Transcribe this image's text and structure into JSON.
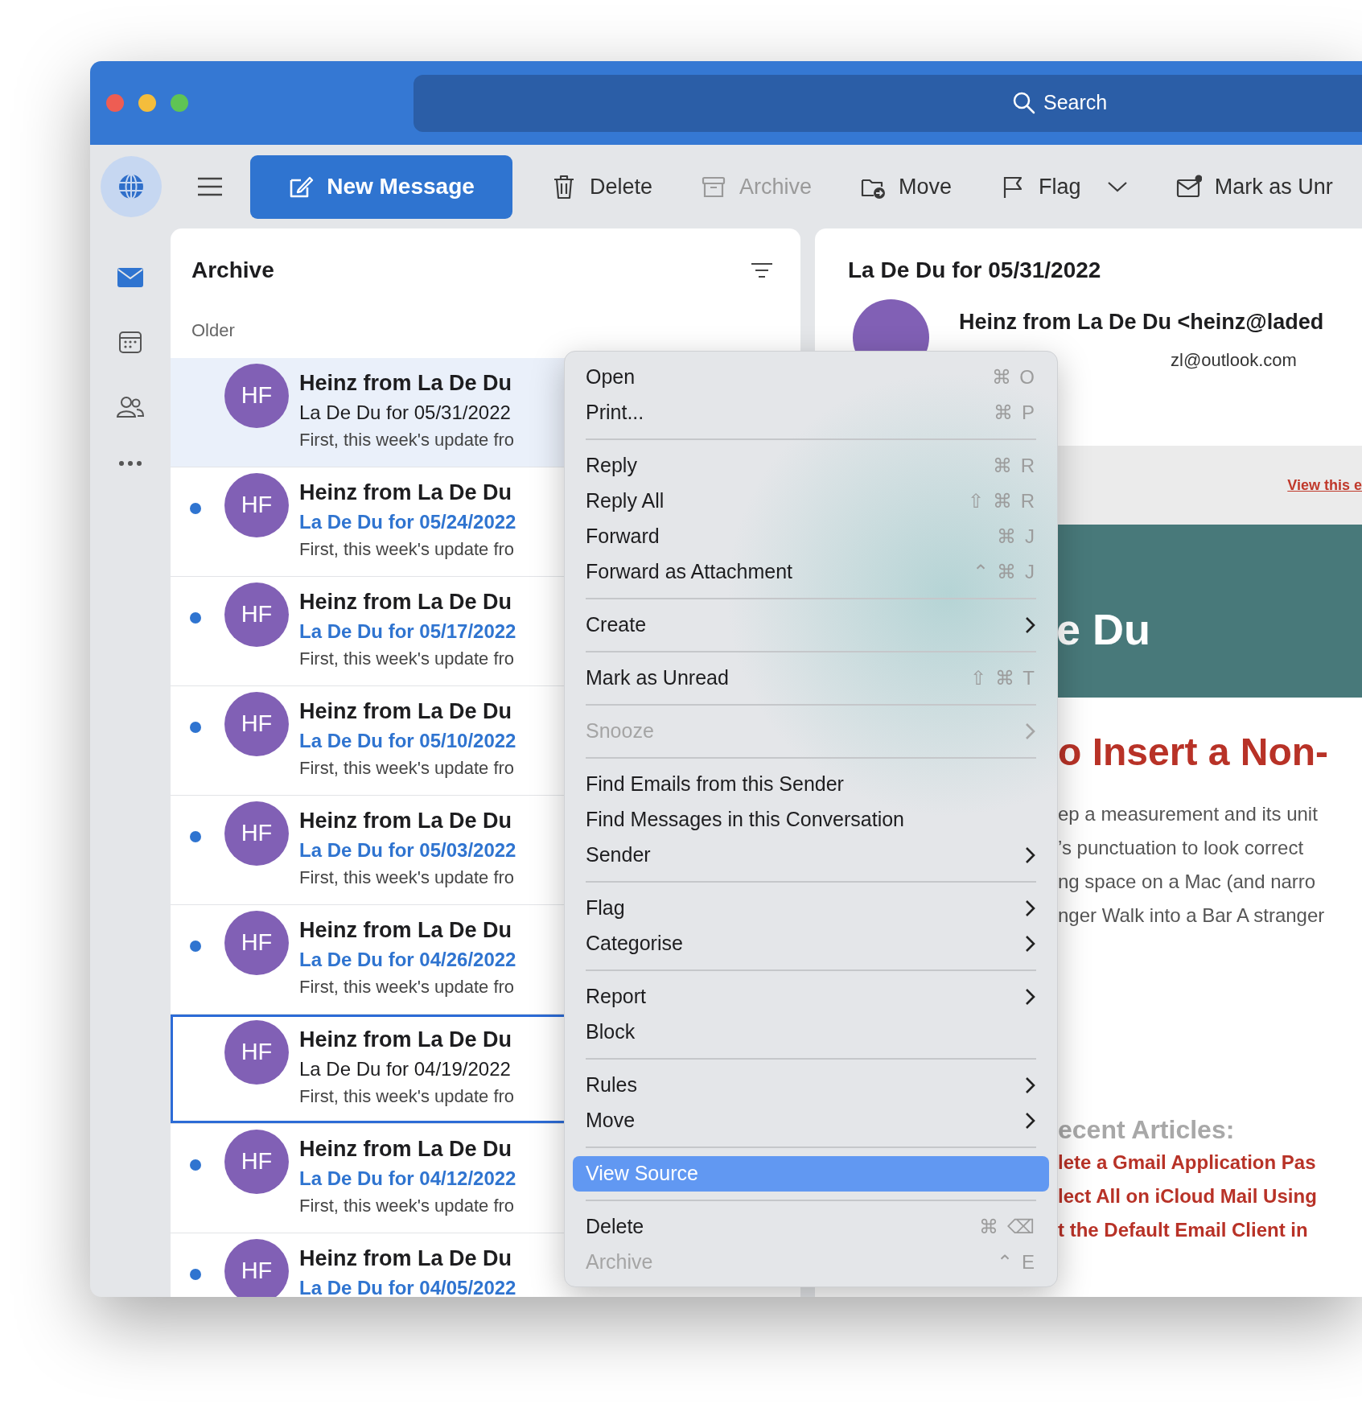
{
  "search": {
    "placeholder": "Search"
  },
  "toolbar": [
    {
      "label": "New Message",
      "kind": "compose",
      "disabled": false
    },
    {
      "label": "Delete",
      "kind": "delete",
      "disabled": false
    },
    {
      "label": "Archive",
      "kind": "archive",
      "disabled": true
    },
    {
      "label": "Move",
      "kind": "move",
      "disabled": false
    },
    {
      "label": "Flag",
      "kind": "flag",
      "disabled": false,
      "dropdown": true
    },
    {
      "label": "Mark as Unr",
      "kind": "unread",
      "disabled": false
    }
  ],
  "nav_rail": [
    {
      "kind": "mail",
      "selected": true
    },
    {
      "kind": "calendar",
      "selected": false
    },
    {
      "kind": "people",
      "selected": false
    },
    {
      "kind": "more",
      "selected": false
    }
  ],
  "message_list": {
    "title": "Archive",
    "group": "Older",
    "messages": [
      {
        "initials": "HF",
        "sender": "Heinz from La De Du",
        "subject": "La De Du for 05/31/2022",
        "preview": "First, this week's update fro",
        "unread": false,
        "selected": true,
        "focused": false
      },
      {
        "initials": "HF",
        "sender": "Heinz from La De Du",
        "subject": "La De Du for 05/24/2022",
        "preview": "First, this week's update fro",
        "unread": true,
        "selected": false,
        "focused": false
      },
      {
        "initials": "HF",
        "sender": "Heinz from La De Du",
        "subject": "La De Du for 05/17/2022",
        "preview": "First, this week's update fro",
        "unread": true,
        "selected": false,
        "focused": false
      },
      {
        "initials": "HF",
        "sender": "Heinz from La De Du",
        "subject": "La De Du for 05/10/2022",
        "preview": "First, this week's update fro",
        "unread": true,
        "selected": false,
        "focused": false
      },
      {
        "initials": "HF",
        "sender": "Heinz from La De Du",
        "subject": "La De Du for 05/03/2022",
        "preview": "First, this week's update fro",
        "unread": true,
        "selected": false,
        "focused": false
      },
      {
        "initials": "HF",
        "sender": "Heinz from La De Du",
        "subject": "La De Du for 04/26/2022",
        "preview": "First, this week's update fro",
        "unread": true,
        "selected": false,
        "focused": false
      },
      {
        "initials": "HF",
        "sender": "Heinz from La De Du",
        "subject": "La De Du for 04/19/2022",
        "preview": "First, this week's update fro",
        "unread": false,
        "selected": false,
        "focused": true
      },
      {
        "initials": "HF",
        "sender": "Heinz from La De Du",
        "subject": "La De Du for 04/12/2022",
        "preview": "First, this week's update fro",
        "unread": true,
        "selected": false,
        "focused": false
      },
      {
        "initials": "HF",
        "sender": "Heinz from La De Du",
        "subject": "La De Du for 04/05/2022",
        "unread": true,
        "selected": false,
        "focused": false
      }
    ]
  },
  "reading_pane": {
    "subject": "La De Du for 05/31/2022",
    "from": "Heinz from La De Du <heinz@laded",
    "to": "zl@outlook.com",
    "view_online": "View this e",
    "banner_title": "e Du",
    "heading": "o Insert a Non-",
    "body_lines": [
      "ep a measurement and its unit",
      "’s punctuation to look correct",
      "ng space on a Mac (and narro",
      "nger Walk into a Bar A stranger"
    ],
    "articles_title": "ecent Articles:",
    "articles": [
      "lete a Gmail Application Pas",
      "lect All on iCloud Mail Using",
      "t the Default Email Client in"
    ]
  },
  "context_menu": [
    {
      "kind": "item",
      "label": "Open",
      "shortcut": "⌘ O",
      "submenu": false,
      "disabled": false,
      "selected": false
    },
    {
      "kind": "item",
      "label": "Print...",
      "shortcut": "⌘ P",
      "submenu": false,
      "disabled": false,
      "selected": false
    },
    {
      "kind": "separator"
    },
    {
      "kind": "item",
      "label": "Reply",
      "shortcut": "⌘ R",
      "submenu": false,
      "disabled": false,
      "selected": false
    },
    {
      "kind": "item",
      "label": "Reply All",
      "shortcut": "⇧ ⌘ R",
      "submenu": false,
      "disabled": false,
      "selected": false
    },
    {
      "kind": "item",
      "label": "Forward",
      "shortcut": "⌘ J",
      "submenu": false,
      "disabled": false,
      "selected": false
    },
    {
      "kind": "item",
      "label": "Forward as Attachment",
      "shortcut": "⌃ ⌘ J",
      "submenu": false,
      "disabled": false,
      "selected": false
    },
    {
      "kind": "separator"
    },
    {
      "kind": "item",
      "label": "Create",
      "submenu": true,
      "disabled": false,
      "selected": false
    },
    {
      "kind": "separator"
    },
    {
      "kind": "item",
      "label": "Mark as Unread",
      "shortcut": "⇧ ⌘ T",
      "submenu": false,
      "disabled": false,
      "selected": false
    },
    {
      "kind": "separator"
    },
    {
      "kind": "item",
      "label": "Snooze",
      "submenu": true,
      "disabled": true,
      "selected": false
    },
    {
      "kind": "separator"
    },
    {
      "kind": "item",
      "label": "Find Emails from this Sender",
      "submenu": false,
      "disabled": false,
      "selected": false
    },
    {
      "kind": "item",
      "label": "Find Messages in this Conversation",
      "submenu": false,
      "disabled": false,
      "selected": false
    },
    {
      "kind": "item",
      "label": "Sender",
      "submenu": true,
      "disabled": false,
      "selected": false
    },
    {
      "kind": "separator"
    },
    {
      "kind": "item",
      "label": "Flag",
      "submenu": true,
      "disabled": false,
      "selected": false
    },
    {
      "kind": "item",
      "label": "Categorise",
      "submenu": true,
      "disabled": false,
      "selected": false
    },
    {
      "kind": "separator"
    },
    {
      "kind": "item",
      "label": "Report",
      "submenu": true,
      "disabled": false,
      "selected": false
    },
    {
      "kind": "item",
      "label": "Block",
      "submenu": false,
      "disabled": false,
      "selected": false
    },
    {
      "kind": "separator"
    },
    {
      "kind": "item",
      "label": "Rules",
      "submenu": true,
      "disabled": false,
      "selected": false
    },
    {
      "kind": "item",
      "label": "Move",
      "submenu": true,
      "disabled": false,
      "selected": false
    },
    {
      "kind": "separator"
    },
    {
      "kind": "item",
      "label": "View Source",
      "submenu": false,
      "disabled": false,
      "selected": true
    },
    {
      "kind": "separator"
    },
    {
      "kind": "item",
      "label": "Delete",
      "shortcut": "⌘ ⌫",
      "submenu": false,
      "disabled": false,
      "selected": false
    },
    {
      "kind": "item",
      "label": "Archive",
      "shortcut": "⌃ E",
      "submenu": false,
      "disabled": true,
      "selected": false
    }
  ]
}
